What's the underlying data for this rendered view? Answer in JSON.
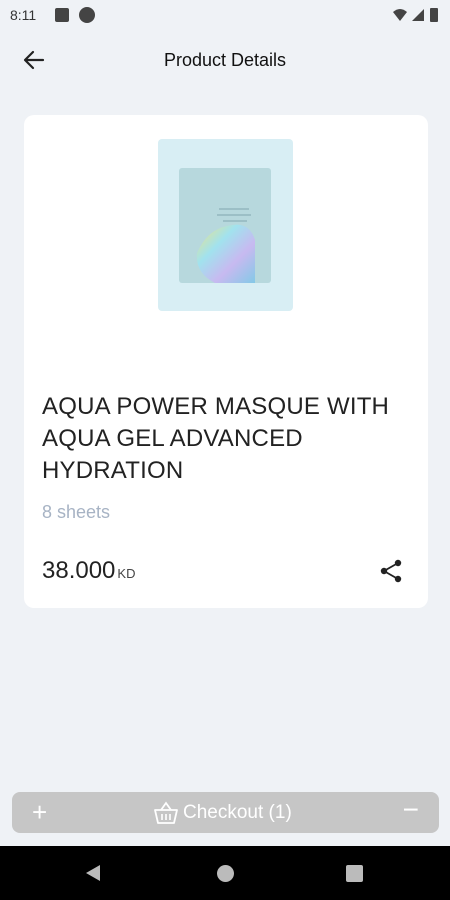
{
  "status": {
    "time": "8:11"
  },
  "header": {
    "title": "Product Details",
    "back_icon": "arrow-left-icon"
  },
  "product": {
    "name": "AQUA POWER MASQUE WITH AQUA GEL ADVANCED HYDRATION",
    "quantity": "8 sheets",
    "price": "38.000",
    "currency": "KD",
    "share_icon": "share-icon"
  },
  "checkout": {
    "plus": "+",
    "label": "Checkout (1)",
    "minus": "−",
    "color": "#c6c6c6"
  },
  "colors": {
    "background": "#eff2f6",
    "card": "#ffffff",
    "muted": "#a7b3c4"
  }
}
